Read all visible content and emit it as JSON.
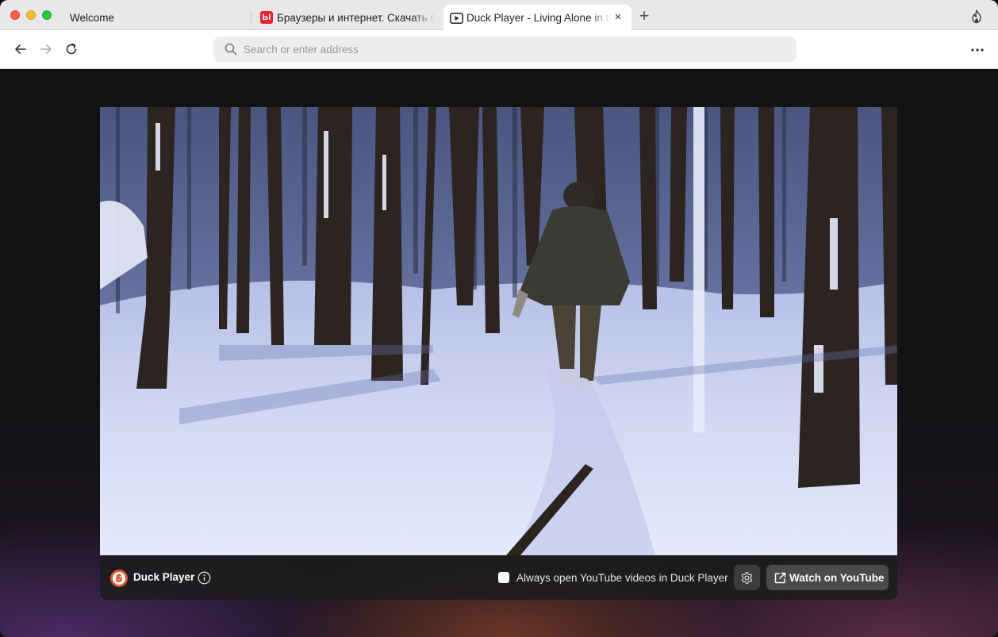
{
  "tabs": [
    {
      "label": "Welcome",
      "favicon": "none"
    },
    {
      "label": "Браузеры и интернет. Скачать бесплатно",
      "favicon": "red-square-icon"
    },
    {
      "label": "Duck Player - Living Alone in the Taiga",
      "favicon": "play-icon",
      "active": true
    }
  ],
  "tab_close_symbol": "×",
  "new_tab_symbol": "+",
  "toolbar": {
    "address_placeholder": "Search or enter address",
    "address_value": ""
  },
  "player": {
    "brand": "Duck Player",
    "checkbox_label": "Always open YouTube videos in Duck Player",
    "checkbox_checked": false,
    "watch_button": "Watch on YouTube"
  },
  "colors": {
    "accent_red": "#e5232a",
    "duck_orange": "#de5833",
    "traffic_close": "#fe5f57",
    "traffic_min": "#febc2e",
    "traffic_max": "#28c840"
  },
  "icons": [
    "back-arrow-icon",
    "forward-arrow-icon",
    "reload-icon",
    "search-icon",
    "more-dots-icon",
    "fire-icon",
    "info-icon",
    "gear-icon",
    "external-link-icon"
  ]
}
